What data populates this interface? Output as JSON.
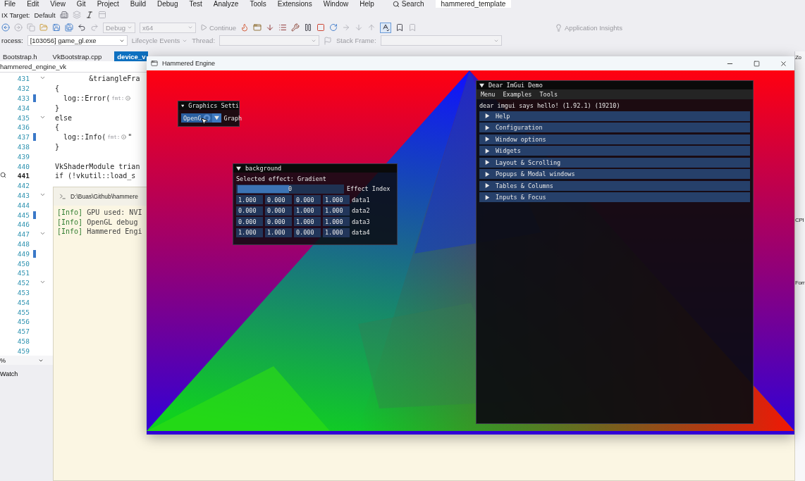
{
  "menu_bar": [
    "File",
    "Edit",
    "View",
    "Git",
    "Project",
    "Build",
    "Debug",
    "Test",
    "Analyze",
    "Tools",
    "Extensions",
    "Window",
    "Help"
  ],
  "search": "Search",
  "solution_title": "hammered_template",
  "toolbar_1": {
    "label": "IX Target:",
    "value": "Default"
  },
  "toolbar_2": {
    "configuration": "Debug",
    "platform": "x64",
    "continue": "Continue",
    "insights": "Application Insights"
  },
  "toolbar_3": {
    "process_label": "rocess:",
    "process": "[103056] game_gl.exe",
    "lifecycle": "Lifecycle Events",
    "thread_label": "Thread:",
    "stack_frame_label": "Stack Frame:"
  },
  "editor_tabs": [
    {
      "label": "Bootstrap.h",
      "selected": false
    },
    {
      "label": "VkBootstrap.cpp",
      "selected": false
    },
    {
      "label": "device_v",
      "selected": true
    }
  ],
  "nav_project": "hammered_engine_vk",
  "code_lines": [
    {
      "number": "431",
      "code": "        &triangleFra",
      "fold": true,
      "changed": false,
      "current": false
    },
    {
      "number": "432",
      "code": "{",
      "fold": false,
      "changed": false,
      "current": false
    },
    {
      "number": "433",
      "code": "  log::Error(",
      "hint": "fmt:",
      "fold": false,
      "changed": true,
      "current": false
    },
    {
      "number": "434",
      "code": "}",
      "fold": false,
      "changed": false,
      "current": false
    },
    {
      "number": "435",
      "code": "else",
      "fold": true,
      "changed": false,
      "current": false
    },
    {
      "number": "436",
      "code": "{",
      "fold": false,
      "changed": false,
      "current": false
    },
    {
      "number": "437",
      "code": "  log::Info(",
      "hint": "fmt:",
      "tail": "\"",
      "fold": false,
      "changed": true,
      "current": false
    },
    {
      "number": "438",
      "code": "}",
      "fold": false,
      "changed": false,
      "current": false
    },
    {
      "number": "439",
      "fold": false,
      "changed": false,
      "current": false
    },
    {
      "number": "440",
      "code": "VkShaderModule trian",
      "fold": false,
      "changed": false,
      "current": false
    },
    {
      "number": "441",
      "code": "if (!vkutil::load_s",
      "fold": false,
      "changed": false,
      "current": true
    },
    {
      "number": "442",
      "fold": false,
      "changed": false,
      "current": false
    },
    {
      "number": "443",
      "fold": true,
      "changed": false,
      "current": false
    },
    {
      "number": "444",
      "fold": false,
      "changed": false,
      "current": false
    },
    {
      "number": "445",
      "fold": false,
      "changed": true,
      "current": false
    },
    {
      "number": "446",
      "fold": false,
      "changed": false,
      "current": false
    },
    {
      "number": "447",
      "fold": true,
      "changed": false,
      "current": false
    },
    {
      "number": "448",
      "fold": false,
      "changed": false,
      "current": false
    },
    {
      "number": "449",
      "fold": false,
      "changed": true,
      "current": false
    },
    {
      "number": "450",
      "fold": false,
      "changed": false,
      "current": false
    },
    {
      "number": "451",
      "fold": false,
      "changed": false,
      "current": false
    },
    {
      "number": "452",
      "fold": true,
      "changed": false,
      "current": false
    },
    {
      "number": "453",
      "fold": false,
      "changed": false,
      "current": false
    },
    {
      "number": "454",
      "fold": false,
      "changed": false,
      "current": false
    },
    {
      "number": "455",
      "fold": false,
      "changed": false,
      "current": false
    },
    {
      "number": "456",
      "fold": false,
      "changed": false,
      "current": false
    },
    {
      "number": "457",
      "fold": false,
      "changed": false,
      "current": false
    },
    {
      "number": "458",
      "fold": false,
      "changed": false,
      "current": false
    },
    {
      "number": "459",
      "fold": false,
      "changed": false,
      "current": false
    }
  ],
  "zoom": "%",
  "bottom_tab": "Watch",
  "right_panel": [
    "Zo",
    "CPI",
    "Forr"
  ],
  "console": {
    "title": "D:\\Buas\\Github\\hammere",
    "lines": [
      {
        "tag": "[Info]",
        "text": "GPU used: NVI"
      },
      {
        "tag": "[Info]",
        "text": "OpenGL debug"
      },
      {
        "tag": "[Info]",
        "text": "Hammered Engi"
      }
    ]
  },
  "game_window": {
    "title": "Hammered Engine"
  },
  "graphics_settings": {
    "title": "Graphics Setti",
    "combo": "OpenG",
    "label": "Graph"
  },
  "background": {
    "title": "background",
    "selected_text": "Selected effect: Gradient",
    "slider": {
      "level": 0.5,
      "reading": "0",
      "label": "Effect Index"
    },
    "rows": [
      {
        "values": [
          "1.000",
          "0.000",
          "0.000",
          "1.000"
        ],
        "label": "data1"
      },
      {
        "values": [
          "0.000",
          "0.000",
          "1.000",
          "1.000"
        ],
        "label": "data2"
      },
      {
        "values": [
          "0.000",
          "0.000",
          "1.000",
          "1.000"
        ],
        "label": "data3"
      },
      {
        "values": [
          "1.000",
          "1.000",
          "0.000",
          "1.000"
        ],
        "label": "data4"
      }
    ]
  },
  "demo": {
    "title": "Dear ImGui Demo",
    "menu": [
      "Menu",
      "Examples",
      "Tools"
    ],
    "hello": "dear imgui says hello! (1.92.1) (19210)",
    "headers": [
      "Help",
      "Configuration",
      "Window options",
      "Widgets",
      "Layout & Scrolling",
      "Popups & Modal windows",
      "Tables & Columns",
      "Inputs & Focus"
    ]
  }
}
